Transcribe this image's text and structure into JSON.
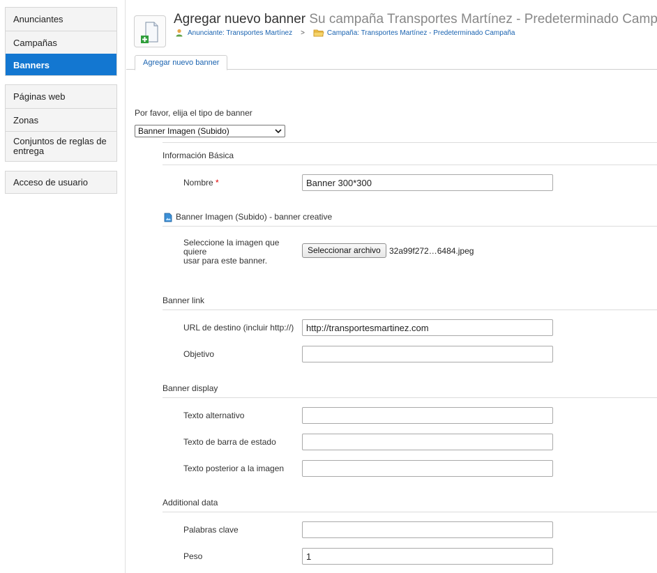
{
  "sidebar": {
    "group1": [
      "Anunciantes",
      "Campañas",
      "Banners"
    ],
    "group2": [
      "Páginas web",
      "Zonas",
      "Conjuntos de reglas de entrega"
    ],
    "group3": [
      "Acceso de usuario"
    ]
  },
  "header": {
    "title": "Agregar nuevo banner",
    "subtitle": "Su campaña Transportes Martínez - Predeterminado Campaña",
    "breadcrumb_advertiser": "Anunciante: Transportes Martínez",
    "breadcrumb_separator": ">",
    "breadcrumb_campaign": "Campaña: Transportes Martínez - Predeterminado Campaña"
  },
  "tab": {
    "label": "Agregar nuevo banner"
  },
  "form": {
    "type_prompt": "Por favor, elija el tipo de banner",
    "type_selected": "Banner Imagen (Subido)",
    "basic_info_title": "Información Básica",
    "name_label": "Nombre",
    "name_required": "*",
    "name_value": "Banner 300*300",
    "creative_title": "Banner Imagen (Subido) - banner creative",
    "image_label_line1": "Seleccione la imagen que",
    "image_label_line2": "quiere",
    "image_label_line3": "usar para este banner.",
    "file_button": "Seleccionar archivo",
    "file_name": "32a99f272…6484.jpeg",
    "link_title": "Banner link",
    "url_label": "URL de destino (incluir http://)",
    "url_value": "http://transportesmartinez.com",
    "target_label": "Objetivo",
    "target_value": "",
    "display_title": "Banner display",
    "alt_label": "Texto alternativo",
    "alt_value": "",
    "status_label": "Texto de barra de estado",
    "status_value": "",
    "after_label": "Texto posterior a la imagen",
    "after_value": "",
    "additional_title": "Additional data",
    "keywords_label": "Palabras clave",
    "keywords_value": "",
    "weight_label": "Peso",
    "weight_value": "1"
  },
  "colors": {
    "accent": "#1377d1",
    "link": "#1a63b0",
    "required": "#dd0000"
  }
}
